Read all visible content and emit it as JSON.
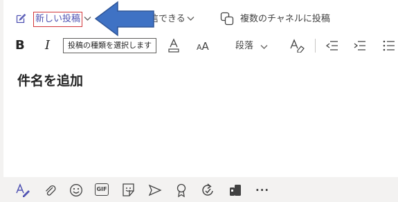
{
  "compose_header": {
    "new_post_label": "新しい投稿",
    "reply_label_partial": "信できる",
    "multi_channel_label": "複数のチャネルに投稿"
  },
  "tooltip": {
    "text": "投稿の種類を選択します"
  },
  "format_toolbar": {
    "paragraph_label": "段落"
  },
  "editor": {
    "subject_placeholder": "件名を追加"
  },
  "bottom_toolbar": {
    "gif_label": "GIF",
    "more_label": "···"
  },
  "colors": {
    "accent": "#4f52b2",
    "highlight_border": "#d13438",
    "arrow_fill": "#3f72c4",
    "arrow_stroke": "#2f5597"
  }
}
